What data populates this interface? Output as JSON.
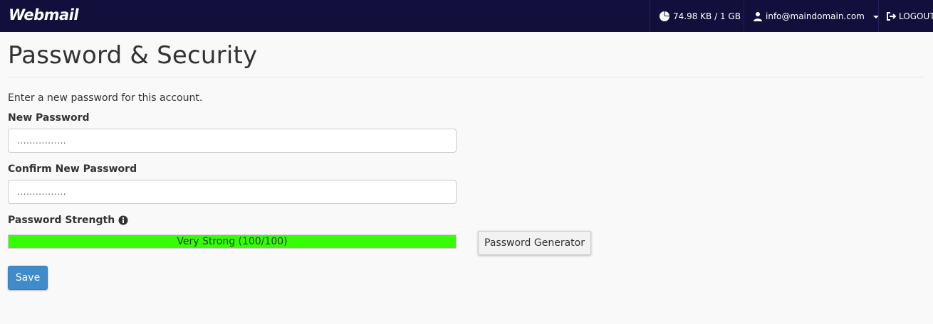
{
  "header": {
    "logo_text": "Webmail",
    "quota": "74.98 KB / 1 GB",
    "user_email": "info@maindomain.com",
    "logout_label": "LOGOUT"
  },
  "page": {
    "title": "Password & Security",
    "intro": "Enter a new password for this account."
  },
  "form": {
    "new_password_label": "New Password",
    "new_password_value": "................",
    "confirm_password_label": "Confirm New Password",
    "confirm_password_value": "................",
    "strength_label": "Password Strength",
    "strength_text": "Very Strong (100/100)",
    "strength_percent": 100,
    "strength_color": "#33ff00",
    "generator_label": "Password Generator",
    "save_label": "Save"
  },
  "colors": {
    "topbar": "#120f3d",
    "primary": "#428bca"
  },
  "icons": {
    "quota": "pie-chart-icon",
    "user": "user-icon",
    "logout": "logout-icon",
    "info": "info-circle-icon",
    "dropdown": "caret-down-icon"
  }
}
